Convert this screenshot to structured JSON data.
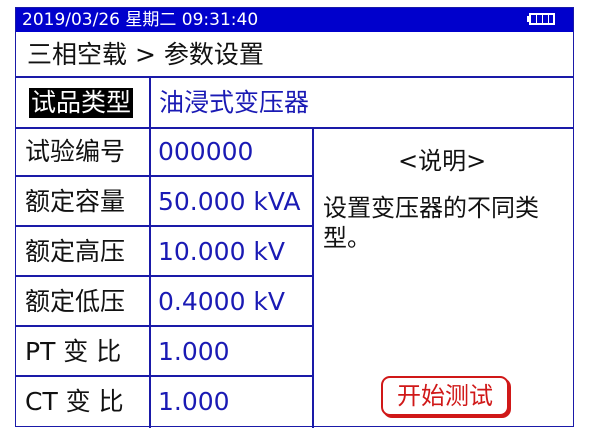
{
  "statusbar": {
    "datetime": "2019/03/26 星期二 09:31:40",
    "battery_icon": "battery-full-icon"
  },
  "breadcrumb": {
    "text": "三相空载 > 参数设置"
  },
  "type_row": {
    "label": "试品类型",
    "value": "油浸式变压器"
  },
  "params": [
    {
      "label": "试验编号",
      "value": "000000"
    },
    {
      "label": "额定容量",
      "value": "50.000 kVA"
    },
    {
      "label": "额定高压",
      "value": "10.000 kV"
    },
    {
      "label": "额定低压",
      "value": "0.4000 kV"
    },
    {
      "label": "PT 变 比",
      "value": "1.000"
    },
    {
      "label": "CT 变 比",
      "value": "1.000"
    }
  ],
  "help": {
    "title": "<说明>",
    "text": "设置变压器的不同类型。"
  },
  "actions": {
    "start_label": "开始测试"
  },
  "colors": {
    "status_bg": "#0000cc",
    "border": "#1a1aa8",
    "value_text": "#1a1ab4",
    "button_red": "#d01818"
  }
}
